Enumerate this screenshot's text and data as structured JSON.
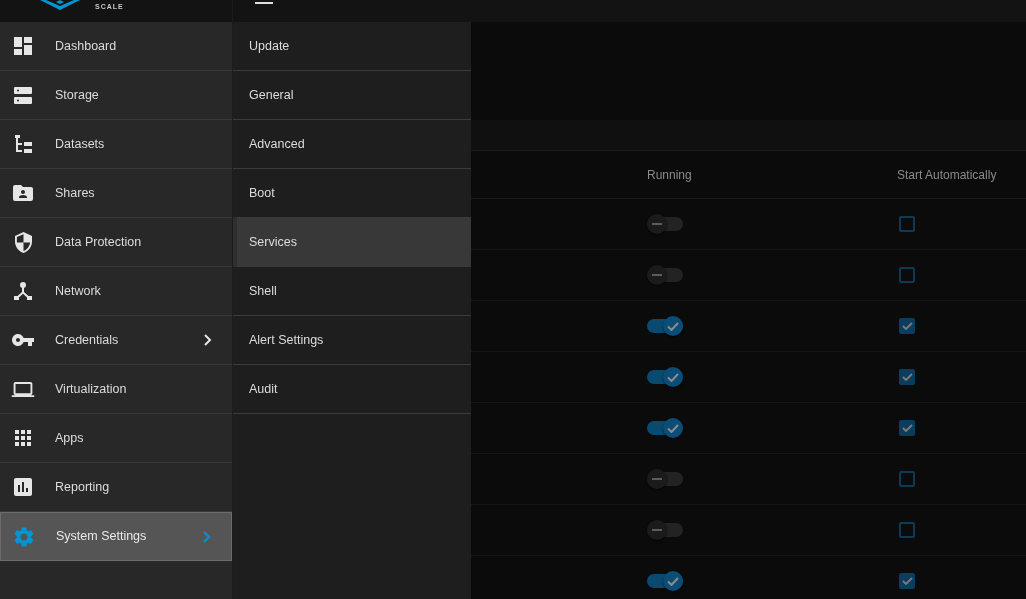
{
  "logo": {
    "edition": "SCALE"
  },
  "sidebar": {
    "items": [
      {
        "label": "Dashboard",
        "selected": false,
        "has_submenu": false
      },
      {
        "label": "Storage",
        "selected": false,
        "has_submenu": false
      },
      {
        "label": "Datasets",
        "selected": false,
        "has_submenu": false
      },
      {
        "label": "Shares",
        "selected": false,
        "has_submenu": false
      },
      {
        "label": "Data Protection",
        "selected": false,
        "has_submenu": false
      },
      {
        "label": "Network",
        "selected": false,
        "has_submenu": false
      },
      {
        "label": "Credentials",
        "selected": false,
        "has_submenu": true
      },
      {
        "label": "Virtualization",
        "selected": false,
        "has_submenu": false
      },
      {
        "label": "Apps",
        "selected": false,
        "has_submenu": false
      },
      {
        "label": "Reporting",
        "selected": false,
        "has_submenu": false
      },
      {
        "label": "System Settings",
        "selected": true,
        "has_submenu": true
      }
    ]
  },
  "submenu": {
    "items": [
      {
        "label": "Update",
        "selected": false
      },
      {
        "label": "General",
        "selected": false
      },
      {
        "label": "Advanced",
        "selected": false
      },
      {
        "label": "Boot",
        "selected": false
      },
      {
        "label": "Services",
        "selected": true
      },
      {
        "label": "Shell",
        "selected": false
      },
      {
        "label": "Alert Settings",
        "selected": false
      },
      {
        "label": "Audit",
        "selected": false
      }
    ]
  },
  "services_table": {
    "columns": [
      {
        "label": "Running"
      },
      {
        "label": "Start Automatically"
      }
    ],
    "rows": [
      {
        "running": false,
        "start_automatically": false
      },
      {
        "running": false,
        "start_automatically": false
      },
      {
        "running": true,
        "start_automatically": true
      },
      {
        "running": true,
        "start_automatically": true
      },
      {
        "running": true,
        "start_automatically": true
      },
      {
        "running": false,
        "start_automatically": false
      },
      {
        "running": false,
        "start_automatically": false
      },
      {
        "running": true,
        "start_automatically": true
      }
    ]
  }
}
